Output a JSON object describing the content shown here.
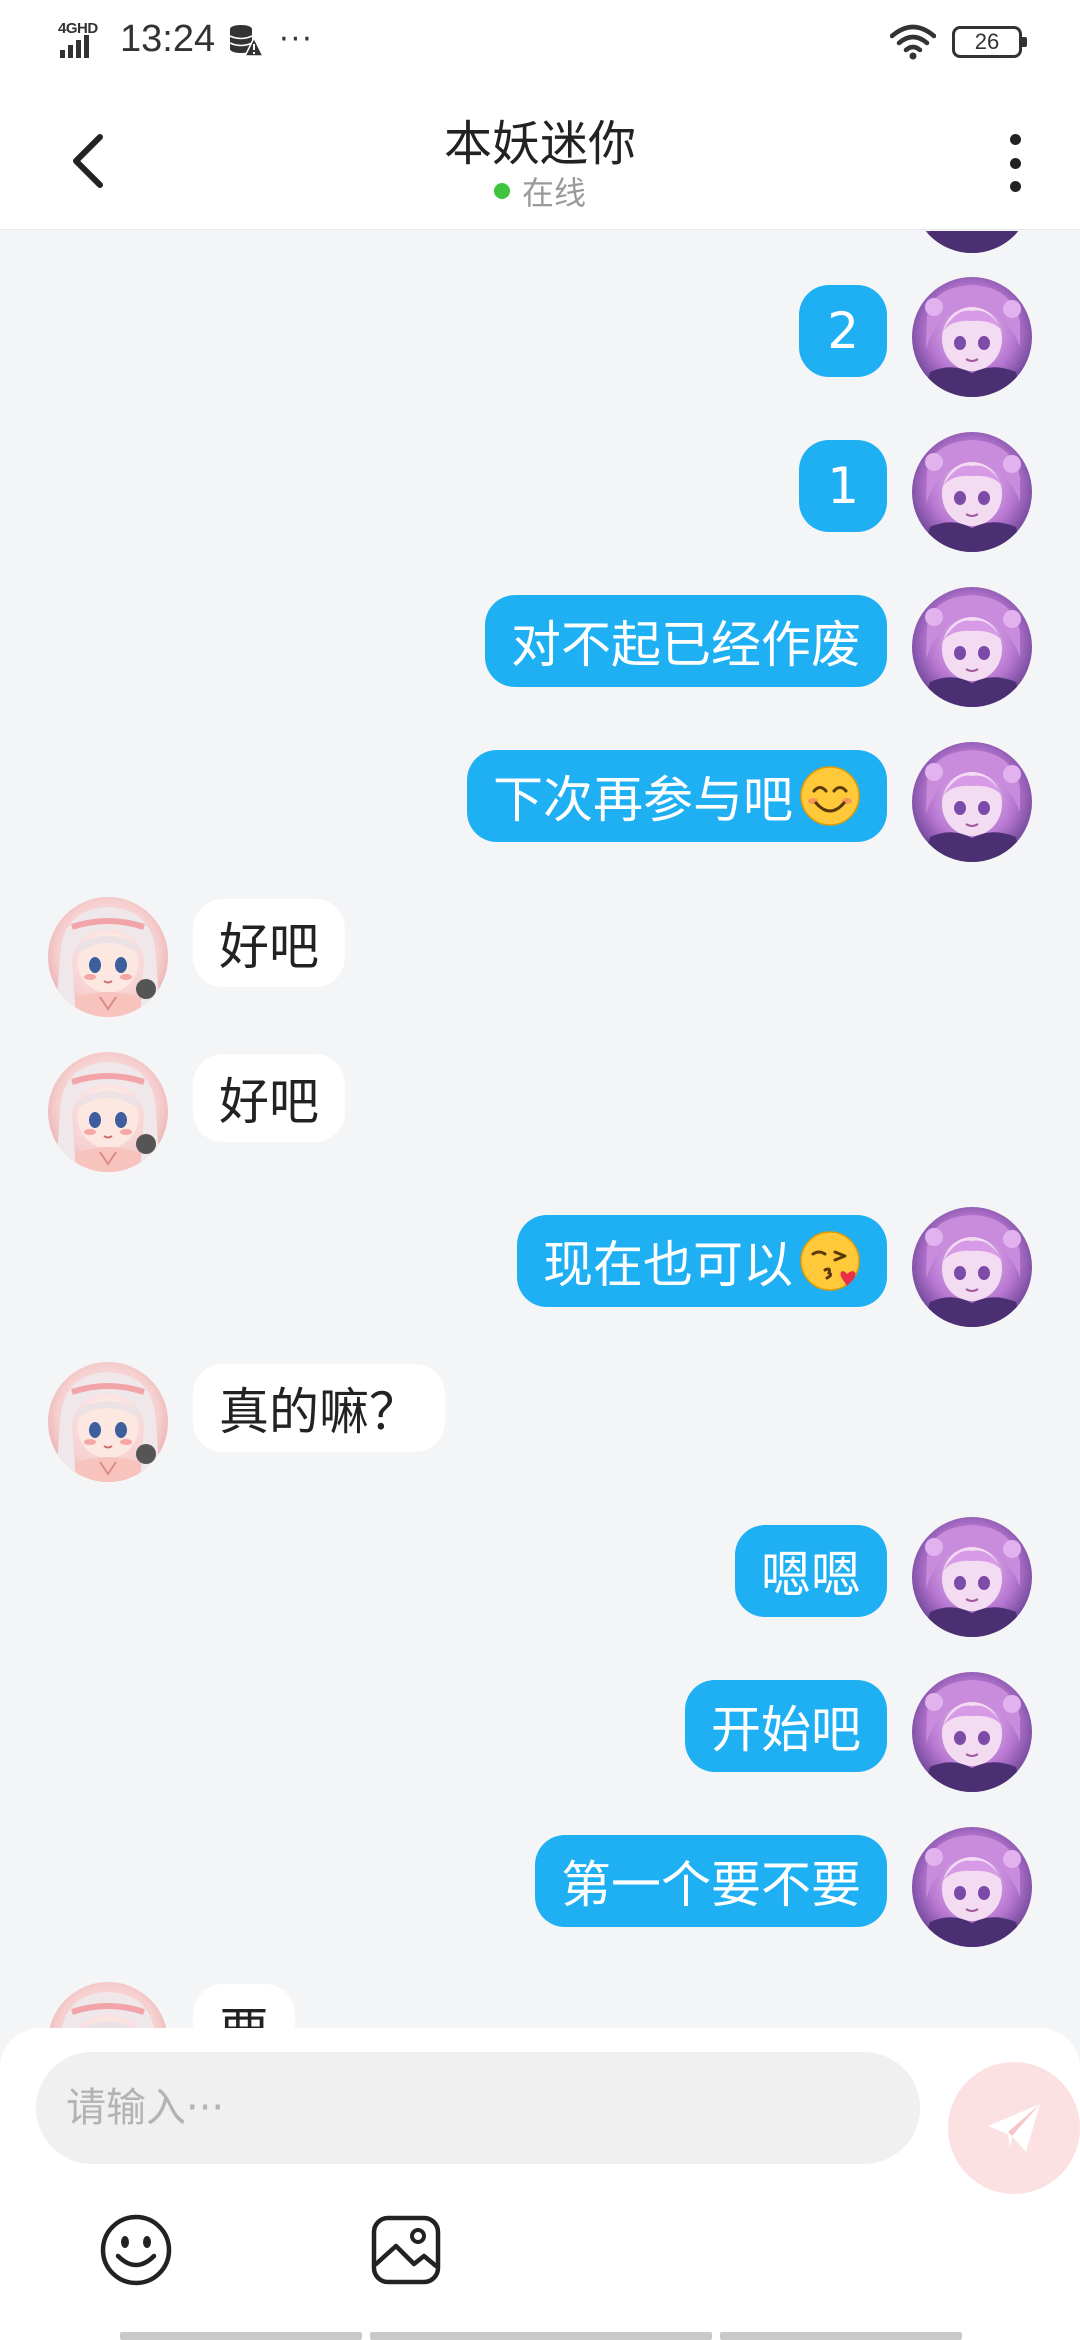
{
  "status_bar": {
    "network": "4GHD",
    "time": "13:24",
    "battery": "26",
    "icons": [
      "signal-icon",
      "database-warning-icon",
      "more-dots-icon",
      "wifi-icon",
      "battery-icon"
    ]
  },
  "header": {
    "title": "本妖迷你",
    "status": "在线",
    "status_color": "#3ec43e"
  },
  "messages": [
    {
      "side": "sent",
      "text": "2"
    },
    {
      "side": "sent",
      "text": "1"
    },
    {
      "side": "sent",
      "text": "对不起已经作废"
    },
    {
      "side": "sent",
      "text": "下次再参与吧",
      "emoji": "smiling-face-emoji"
    },
    {
      "side": "received",
      "text": "好吧"
    },
    {
      "side": "received",
      "text": "好吧"
    },
    {
      "side": "sent",
      "text": "现在也可以",
      "emoji": "face-blowing-kiss-emoji"
    },
    {
      "side": "received",
      "text": "真的嘛？"
    },
    {
      "side": "sent",
      "text": "嗯嗯"
    },
    {
      "side": "sent",
      "text": "开始吧"
    },
    {
      "side": "sent",
      "text": "第一个要不要"
    },
    {
      "side": "received",
      "text": "要"
    }
  ],
  "composer": {
    "placeholder": "请输入···",
    "send_icon": "paper-plane-icon",
    "tools": [
      "emoji-icon",
      "image-icon"
    ]
  },
  "colors": {
    "sent_bubble": "#1fb0f4",
    "received_bubble": "#ffffff",
    "background": "#f4f5f7",
    "send_button": "#fbe1e1"
  }
}
